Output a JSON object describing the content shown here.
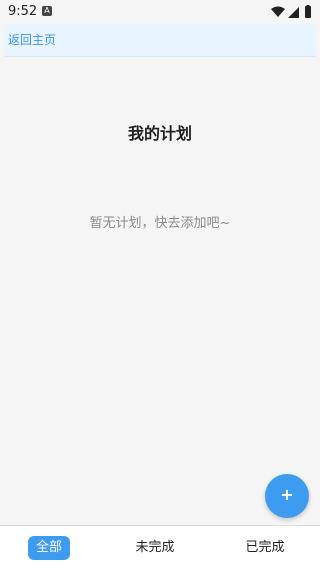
{
  "status_bar": {
    "time": "9:52",
    "notification_letter": "A"
  },
  "header": {
    "back_label": "返回主页"
  },
  "main": {
    "title": "我的计划",
    "empty_message": "暂无计划，快去添加吧~"
  },
  "fab": {
    "label": "+"
  },
  "tabs": [
    {
      "label": "全部",
      "active": true
    },
    {
      "label": "未完成",
      "active": false
    },
    {
      "label": "已完成",
      "active": false
    }
  ],
  "colors": {
    "accent": "#3d9bf0",
    "header_bg": "#e8f4ff",
    "page_bg": "#f5f5f5",
    "muted_text": "#8a8a8a"
  }
}
